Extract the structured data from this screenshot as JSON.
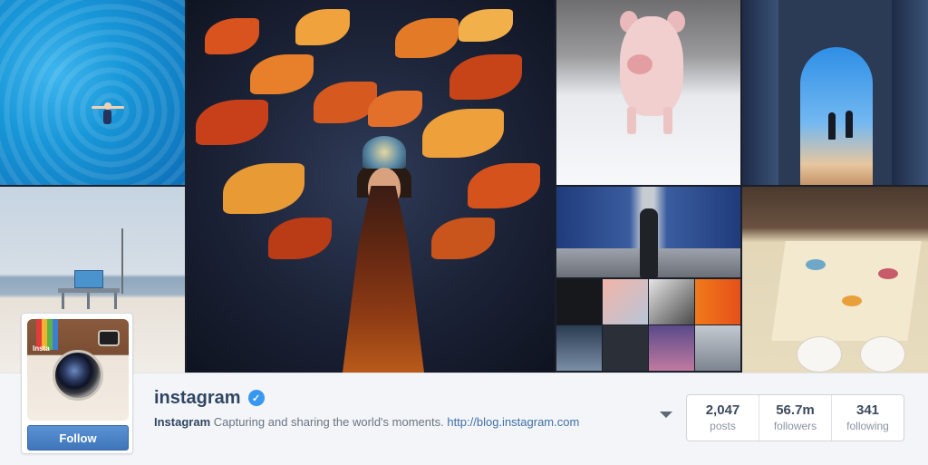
{
  "profile": {
    "username": "instagram",
    "verified": true,
    "full_name": "Instagram",
    "bio": "Capturing and sharing the world's moments.",
    "link": "http://blog.instagram.com",
    "avatar_label": "Insta"
  },
  "actions": {
    "follow_label": "Follow"
  },
  "stats": [
    {
      "value": "2,047",
      "label": "posts"
    },
    {
      "value": "56.7m",
      "label": "followers"
    },
    {
      "value": "341",
      "label": "following"
    }
  ],
  "colors": {
    "accent": "#3f76bb",
    "verified_badge": "#3897f0",
    "username": "#2f4663",
    "link": "#3f6fa8"
  },
  "icons": {
    "verified": "verified-check-icon",
    "menu": "chevron-down-icon"
  },
  "photos": [
    "pool-swimmer",
    "festival-costume",
    "snow-piglet",
    "archway-walkers",
    "beach-lifeguard-tower",
    "subway-platform",
    "art-table"
  ]
}
